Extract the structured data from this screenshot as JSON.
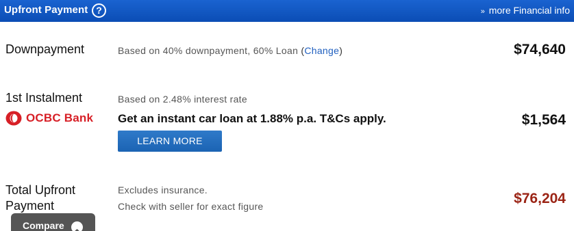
{
  "header": {
    "title": "Upfront Payment",
    "help_icon": "question-circle-icon",
    "more_link": "more Financial info",
    "more_prefix": "»",
    "background_color": "#0b55c4"
  },
  "downpayment": {
    "label": "Downpayment",
    "note_prefix": "Based on 40% downpayment, 60% Loan",
    "note_open": "(",
    "change_link": "Change",
    "note_close": ")",
    "amount": "$74,640"
  },
  "instalment": {
    "label": "1st Instalment",
    "note": "Based on 2.48% interest rate",
    "bank_logo_text": "OCBC Bank",
    "bank_logo_icon": "ocbc-logo-icon",
    "promo": "Get an instant car loan at 1.88% p.a. T&Cs apply.",
    "button": "LEARN MORE",
    "amount": "$1,564"
  },
  "total": {
    "label_line1": "Total Upfront",
    "label_line2": "Payment",
    "note_line1": "Excludes insurance.",
    "note_line2": "Check with seller for exact figure",
    "amount": "$76,204",
    "amount_color": "#9b2415"
  },
  "compare_tab": {
    "label": "Compare",
    "icon": "chevron-up-circle-icon"
  }
}
